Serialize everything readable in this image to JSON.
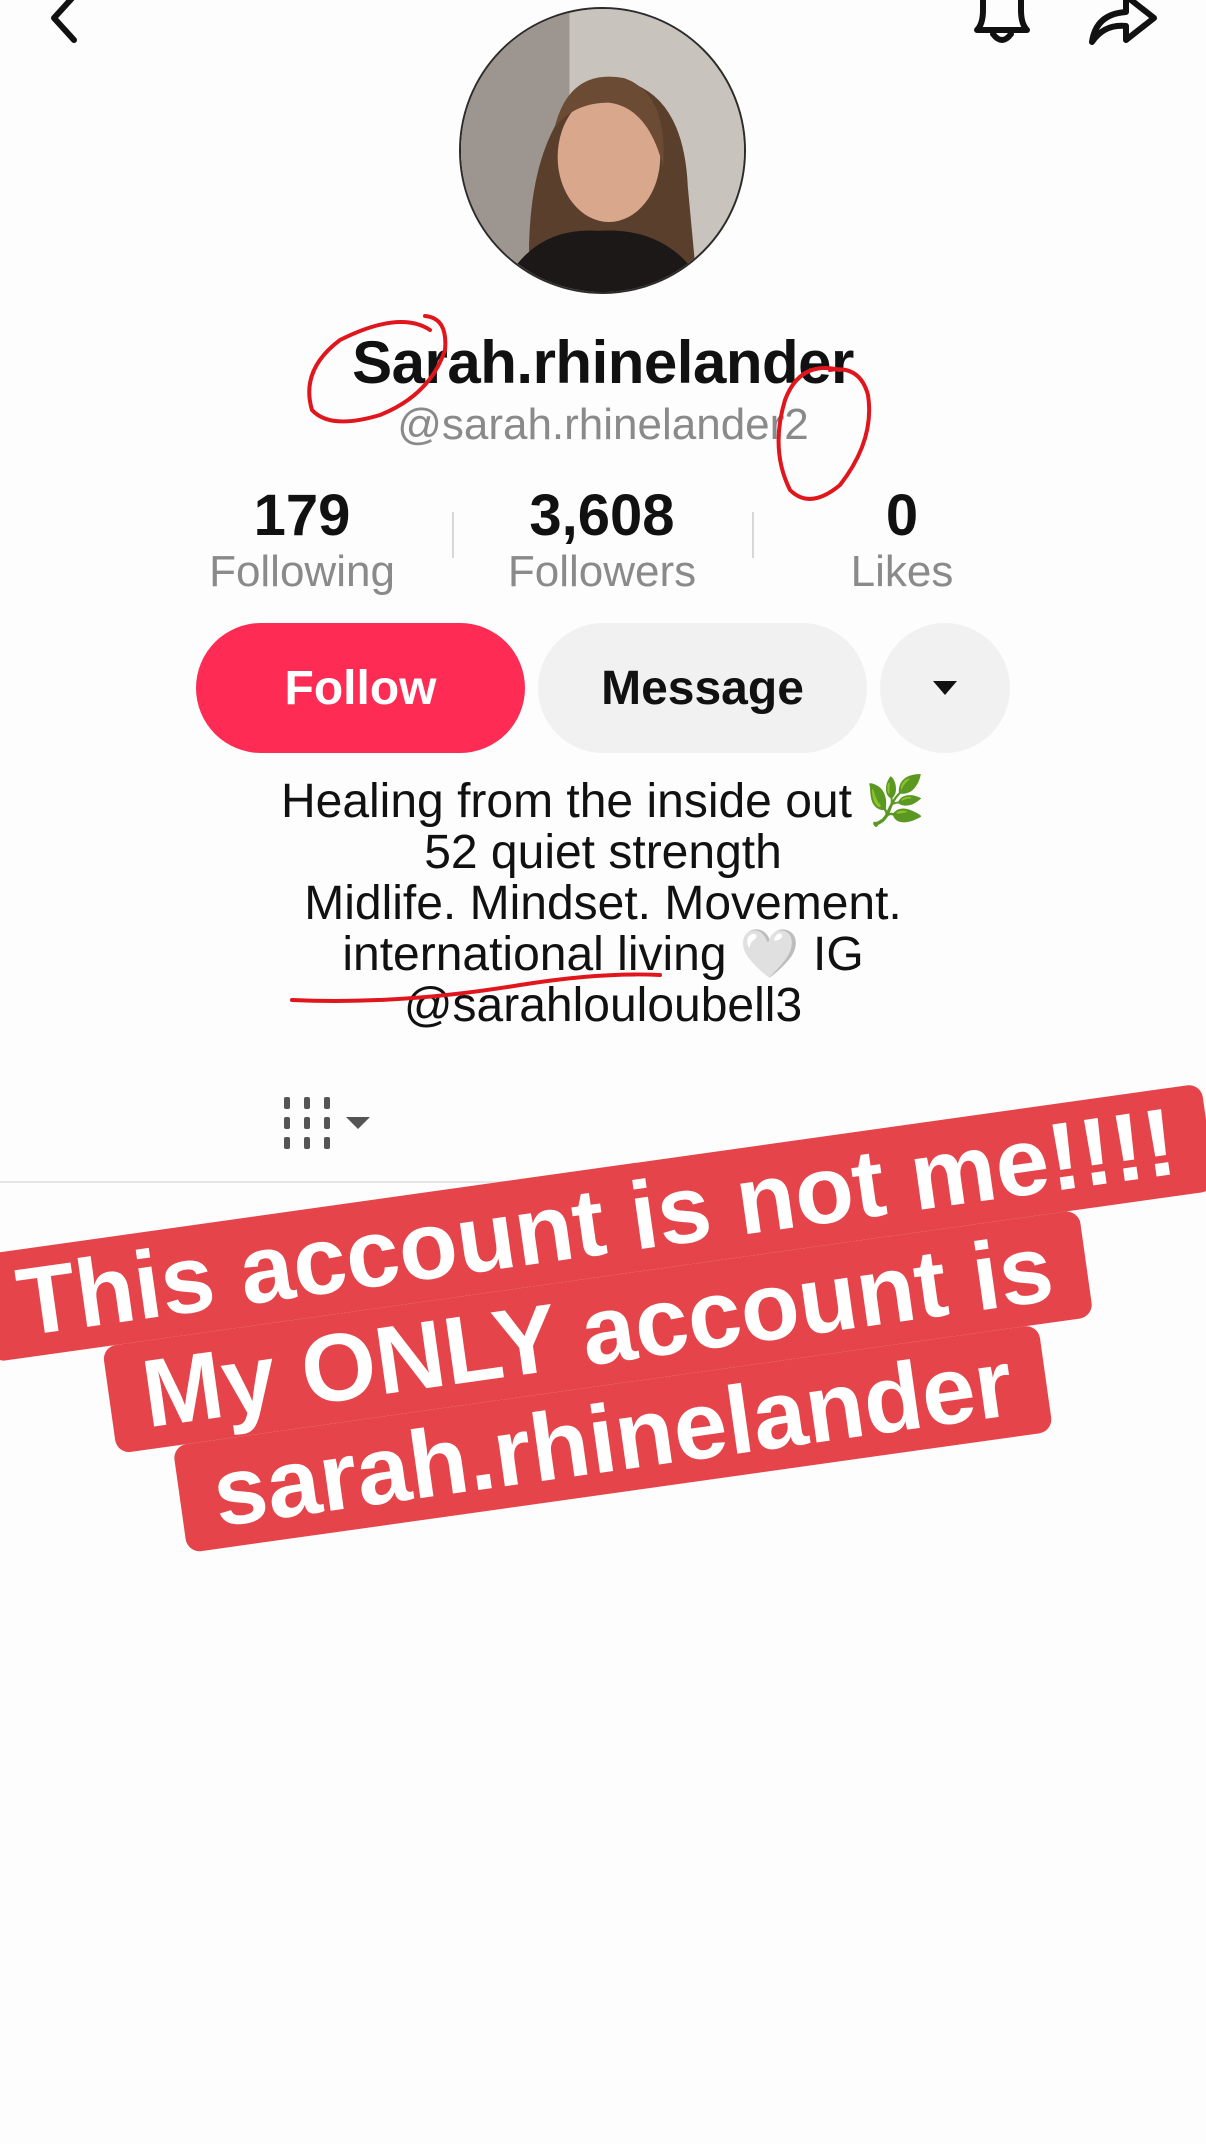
{
  "header": {
    "back_icon": "chevron-left-icon",
    "bell_icon": "bell-icon",
    "share_icon": "share-arrow-icon"
  },
  "profile": {
    "display_name": "Sarah.rhinelander",
    "handle": "@sarah.rhinelander2",
    "stats": [
      {
        "value": "179",
        "label": "Following"
      },
      {
        "value": "3,608",
        "label": "Followers"
      },
      {
        "value": "0",
        "label": "Likes"
      }
    ],
    "buttons": {
      "follow": "Follow",
      "message": "Message",
      "more_icon": "caret-down-icon"
    },
    "bio": [
      "Healing from the inside out 🌿",
      "52 quiet strength",
      "Midlife. Mindset. Movement.",
      "international living 🤍 IG",
      "@sarahlouloubell3"
    ]
  },
  "tabs": {
    "filter_icon": "filter-columns-icon"
  },
  "overlay": {
    "lines": [
      "This account is not me!!!!",
      "My ONLY account is",
      "sarah.rhinelander"
    ],
    "color": "#e4444a"
  },
  "colors": {
    "follow_button": "#fe2c55",
    "secondary_button": "#f1f1f2",
    "annotation_ink": "#e0161c"
  }
}
